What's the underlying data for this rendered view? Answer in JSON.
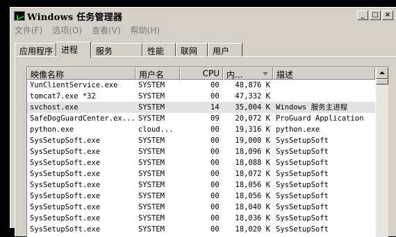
{
  "window": {
    "title": "Windows 任务管理器"
  },
  "titlebar_buttons": [
    "_",
    "□",
    "×"
  ],
  "menu": [
    "文件(F)",
    "选项(O)",
    "查看(V)",
    "帮助(H)"
  ],
  "tabs": [
    {
      "label": "应用程序",
      "active": false
    },
    {
      "label": "进程",
      "active": true
    },
    {
      "label": "服务",
      "active": false
    },
    {
      "label": "性能",
      "active": false
    },
    {
      "label": "联网",
      "active": false
    },
    {
      "label": "用户",
      "active": false
    }
  ],
  "columns": [
    "映像名称",
    "用户名",
    "CPU",
    "内...",
    "描述"
  ],
  "rows": [
    {
      "name": "YunClientService.exe",
      "user": "SYSTEM",
      "cpu": "00",
      "mem": "48,876 K",
      "desc": ""
    },
    {
      "name": "tomcat7.exe *32",
      "user": "SYSTEM",
      "cpu": "00",
      "mem": "47,332 K",
      "desc": ""
    },
    {
      "name": "svchost.exe",
      "user": "SYSTEM",
      "cpu": "14",
      "mem": "35,004 K",
      "desc": "Windows 服务主进程",
      "selected": true
    },
    {
      "name": "SafeDogGuardCenter.ex...",
      "user": "SYSTEM",
      "cpu": "09",
      "mem": "20,072 K",
      "desc": "ProGuard Application"
    },
    {
      "name": "python.exe",
      "user": "cloud...",
      "cpu": "00",
      "mem": "19,316 K",
      "desc": "python.exe"
    },
    {
      "name": "SysSetupSoft.exe",
      "user": "SYSTEM",
      "cpu": "00",
      "mem": "19,000 K",
      "desc": "SysSetupSoft"
    },
    {
      "name": "SysSetupSoft.exe",
      "user": "SYSTEM",
      "cpu": "00",
      "mem": "18,096 K",
      "desc": "SysSetupSoft"
    },
    {
      "name": "SysSetupSoft.exe",
      "user": "SYSTEM",
      "cpu": "00",
      "mem": "18,088 K",
      "desc": "SysSetupSoft"
    },
    {
      "name": "SysSetupSoft.exe",
      "user": "SYSTEM",
      "cpu": "00",
      "mem": "18,072 K",
      "desc": "SysSetupSoft"
    },
    {
      "name": "SysSetupSoft.exe",
      "user": "SYSTEM",
      "cpu": "00",
      "mem": "18,056 K",
      "desc": "SysSetupSoft"
    },
    {
      "name": "SysSetupSoft.exe",
      "user": "SYSTEM",
      "cpu": "00",
      "mem": "18,056 K",
      "desc": "SysSetupSoft"
    },
    {
      "name": "SysSetupSoft.exe",
      "user": "SYSTEM",
      "cpu": "00",
      "mem": "18,040 K",
      "desc": "SysSetupSoft"
    },
    {
      "name": "SysSetupSoft.exe",
      "user": "SYSTEM",
      "cpu": "00",
      "mem": "18,036 K",
      "desc": "SysSetupSoft"
    },
    {
      "name": "SysSetupSoft.exe",
      "user": "SYSTEM",
      "cpu": "00",
      "mem": "18,020 K",
      "desc": "SysSetupSoft"
    }
  ]
}
